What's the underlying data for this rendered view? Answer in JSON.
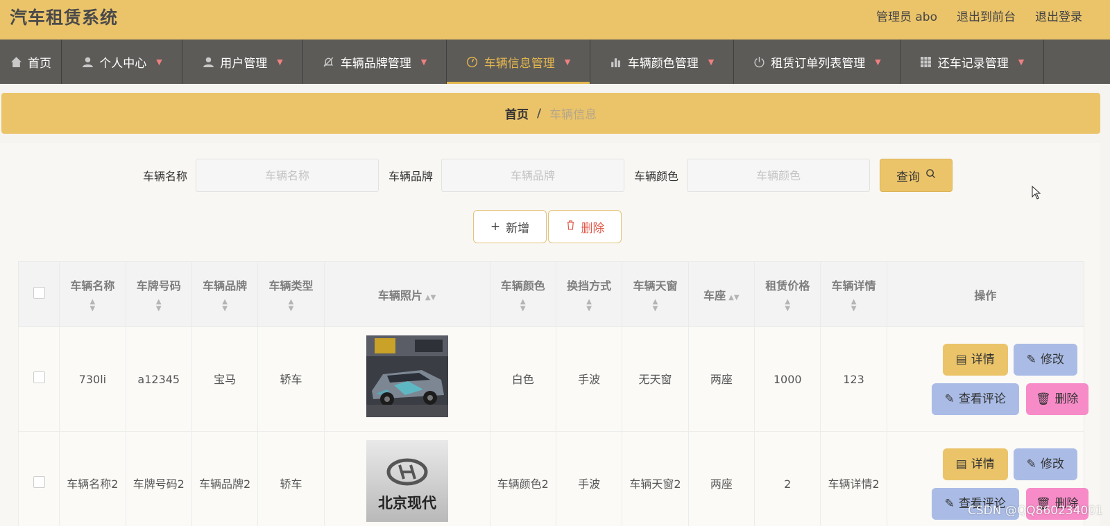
{
  "app": {
    "title": "汽车租赁系统"
  },
  "header": {
    "admin": "管理员 abo",
    "to_front": "退出到前台",
    "logout": "退出登录"
  },
  "nav": [
    {
      "label": "首页",
      "icon": "home-icon"
    },
    {
      "label": "个人中心",
      "icon": "user-icon"
    },
    {
      "label": "用户管理",
      "icon": "user-icon"
    },
    {
      "label": "车辆品牌管理",
      "icon": "bell-off-icon"
    },
    {
      "label": "车辆信息管理",
      "icon": "compass-icon",
      "active": true
    },
    {
      "label": "车辆颜色管理",
      "icon": "bar-chart-icon"
    },
    {
      "label": "租赁订单列表管理",
      "icon": "power-icon"
    },
    {
      "label": "还车记录管理",
      "icon": "grid-icon"
    }
  ],
  "breadcrumb": {
    "home": "首页",
    "separator": "/",
    "current": "车辆信息"
  },
  "search": {
    "name_label": "车辆名称",
    "name_placeholder": "车辆名称",
    "brand_label": "车辆品牌",
    "brand_placeholder": "车辆品牌",
    "color_label": "车辆颜色",
    "color_placeholder": "车辆颜色",
    "query_label": "查询"
  },
  "actions": {
    "add_label": "新增",
    "delete_label": "删除"
  },
  "table": {
    "headers": [
      "车辆名称",
      "车牌号码",
      "车辆品牌",
      "车辆类型",
      "车辆照片",
      "车辆颜色",
      "换挡方式",
      "车辆天窗",
      "车座",
      "租赁价格",
      "车辆详情",
      "操作"
    ],
    "rows": [
      {
        "name": "730li",
        "plate": "a12345",
        "brand": "宝马",
        "type": "轿车",
        "photo": "race-car-photo",
        "color": "白色",
        "gear": "手波",
        "sunroof": "无天窗",
        "seat": "两座",
        "price": "1000",
        "detail": "123"
      },
      {
        "name": "车辆名称2",
        "plate": "车牌号码2",
        "brand": "车辆品牌2",
        "type": "轿车",
        "photo": "hyundai-logo-photo",
        "photo_text": "北京现代",
        "color": "车辆颜色2",
        "gear": "手波",
        "sunroof": "车辆天窗2",
        "seat": "两座",
        "price": "2",
        "detail": "车辆详情2"
      }
    ],
    "ops": {
      "detail": "详情",
      "edit": "修改",
      "review": "查看评论",
      "delete": "删除"
    }
  },
  "watermark": "CSDN @QQ860234001",
  "colors": {
    "header_bg": "#ebc46a",
    "nav_bg": "#5c5b58",
    "active": "#e4b64f",
    "edit_btn": "#aabce6",
    "delete_btn": "#f78bc7"
  }
}
